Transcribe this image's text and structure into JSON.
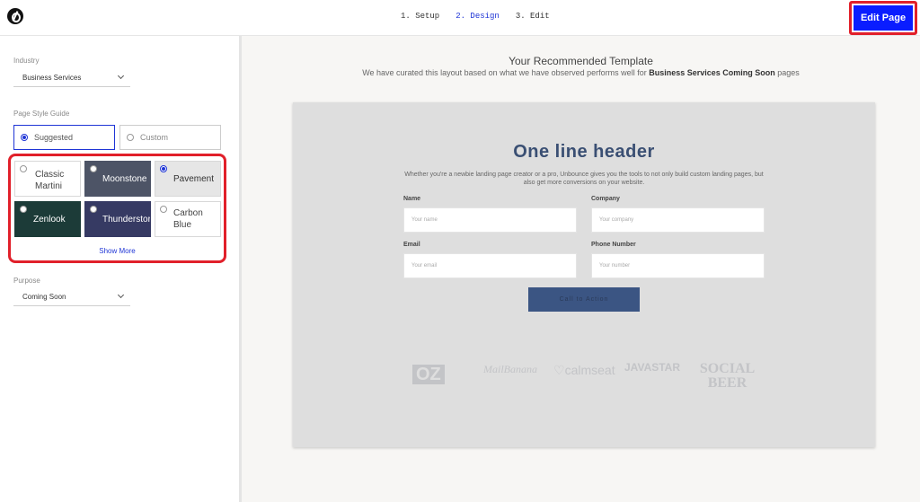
{
  "topbar": {
    "steps": [
      "1. Setup",
      "2. Design",
      "3. Edit"
    ],
    "edit_label": "Edit Page"
  },
  "sidebar": {
    "industry_label": "Industry",
    "industry_value": "Business Services",
    "style_label": "Page Style Guide",
    "style_options": [
      "Suggested",
      "Custom"
    ],
    "themes": [
      {
        "name": "Classic Martini",
        "selected": false
      },
      {
        "name": "Moonstone",
        "selected": false
      },
      {
        "name": "Pavement",
        "selected": true
      },
      {
        "name": "Zenlook",
        "selected": false
      },
      {
        "name": "Thunderstorm",
        "selected": false
      },
      {
        "name": "Carbon Blue",
        "selected": false
      }
    ],
    "show_more": "Show More",
    "purpose_label": "Purpose",
    "purpose_value": "Coming Soon"
  },
  "preview": {
    "title": "Your Recommended Template",
    "subtitle_prefix": "We have curated this layout based on what we have observed performs well for",
    "subtitle_bold": "Business Services Coming Soon",
    "subtitle_suffix": "pages",
    "header": "One line header",
    "intro": "Whether you're a newbie landing page creator or a pro, Unbounce gives you the tools to not only build custom landing pages, but also get more conversions on your website.",
    "fields": {
      "name_label": "Name",
      "name_placeholder": "Your name",
      "company_label": "Company",
      "company_placeholder": "Your company",
      "email_label": "Email",
      "email_placeholder": "Your email",
      "phone_label": "Phone Number",
      "phone_placeholder": "Your number"
    },
    "cta": "Call to Action",
    "logos": [
      "OZ",
      "MailBanana",
      "calmseat",
      "JAVASTAR",
      "SOCIAL BEER"
    ]
  },
  "colors": {
    "accent": "#1f35d6",
    "edit_button": "#0a1dff",
    "highlight": "#e1202a",
    "cta": "#3b5583"
  }
}
